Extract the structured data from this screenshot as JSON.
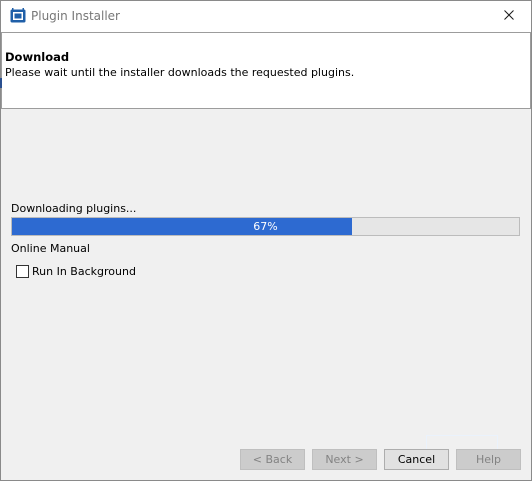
{
  "window": {
    "title": "Plugin Installer",
    "icon": "plugin-installer-app-icon",
    "close_icon": "close-icon"
  },
  "header": {
    "title": "Download",
    "subtitle": "Please wait until the installer downloads the requested plugins."
  },
  "main": {
    "status_label": "Downloading plugins...",
    "progress": {
      "percent": 67,
      "text": "67%",
      "fill_color": "#2d6ad1"
    },
    "manual_link": "Online Manual",
    "run_in_background": {
      "label": "Run In Background",
      "checked": false
    }
  },
  "buttons": {
    "back": {
      "label": "< Back",
      "enabled": false
    },
    "next": {
      "label": "Next >",
      "enabled": false
    },
    "cancel": {
      "label": "Cancel",
      "enabled": true
    },
    "help": {
      "label": "Help",
      "enabled": false
    }
  }
}
